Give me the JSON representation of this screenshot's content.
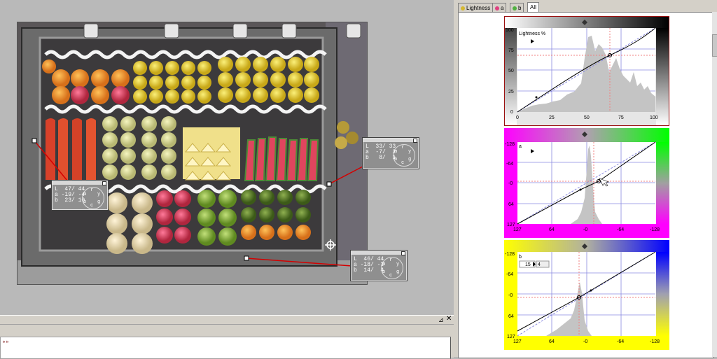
{
  "colors": {
    "panel_bg": "#d4d0c8",
    "workspace_bg": "#b9b9b9",
    "readout_line": "#d40000",
    "grid": "#8a8ae0",
    "magenta": "#ff00ff",
    "green": "#00ff00",
    "yellow": "#ffff00",
    "blue": "#0000ff"
  },
  "readouts": [
    {
      "L": "L  47/ 44",
      "a": "a -19/ -4",
      "b": "b  23/ 10"
    },
    {
      "L": "L  33/ 33",
      "a": "a  -7/  2",
      "b": "b   8/  1"
    },
    {
      "L": "L  46/ 44",
      "a": "a -18/ -3",
      "b": "b  14/  4"
    }
  ],
  "dial_letters": {
    "m": "m",
    "r": "r",
    "y": "y",
    "g": "g",
    "c": "c",
    "b": "b"
  },
  "tabs": [
    {
      "label": "Lightness",
      "icon": "lightness-dot-icon",
      "active": false
    },
    {
      "label": "a",
      "icon": "a-channel-dot-icon",
      "active": false
    },
    {
      "label": "b",
      "icon": "b-channel-dot-icon",
      "active": false
    },
    {
      "label": "All",
      "active": true
    }
  ],
  "curves": {
    "lightness": {
      "label": "Lightness %",
      "y_ticks": [
        "100",
        "75",
        "50",
        "25",
        "0"
      ],
      "x_ticks": [
        "0",
        "25",
        "50",
        "75",
        "100"
      ]
    },
    "a": {
      "label": "a",
      "y_ticks": [
        "-128",
        "-64",
        "-0",
        "64",
        "127"
      ],
      "x_ticks": [
        "127",
        "64",
        "-0",
        "-64",
        "-128"
      ]
    },
    "b": {
      "label": "b",
      "input_value": "15",
      "output_value": "4",
      "y_ticks": [
        "-128",
        "-64",
        "-0",
        "64",
        "127"
      ],
      "x_ticks": [
        "127",
        "64",
        "-0",
        "-64",
        "-128"
      ]
    }
  },
  "bottom_panel": {
    "pin_icon": "pin-icon",
    "close_icon": "close-icon"
  }
}
